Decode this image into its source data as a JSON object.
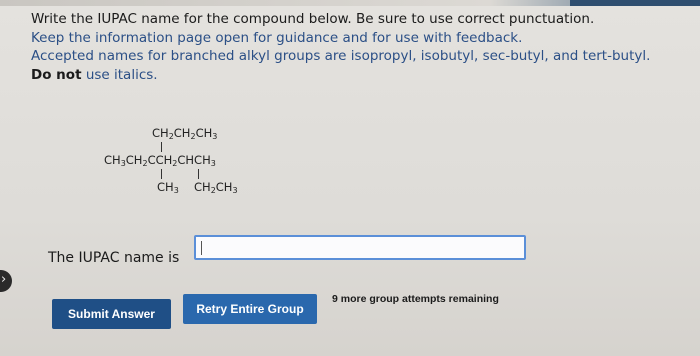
{
  "question": {
    "line1": "Write the IUPAC name for the compound below. Be sure to use correct punctuation.",
    "line2": "Keep the information page open for guidance and for use with feedback.",
    "line3": "Accepted names for branched alkyl groups are isopropyl, isobutyl, sec-butyl, and tert-butyl.",
    "line4_bold": "Do not",
    "line4_rest": " use italics."
  },
  "structure": {
    "top_sub": [
      "CH",
      "2",
      "CH",
      "2",
      "CH",
      "3"
    ],
    "main": [
      "CH",
      "3",
      "CH",
      "2",
      "CCH",
      "2",
      "CHCH",
      "3"
    ],
    "left_sub": [
      "CH",
      "3"
    ],
    "right_sub": [
      "CH",
      "2",
      "CH",
      "3"
    ]
  },
  "answer": {
    "label": "The IUPAC name is",
    "value": ""
  },
  "buttons": {
    "submit": "Submit Answer",
    "retry": "Retry Entire Group"
  },
  "attempts_text": "9 more group attempts remaining",
  "icons": {
    "side_arrow": "arrow-right-icon"
  },
  "colors": {
    "instruction_blue": "#2b4f86",
    "submit_button": "#1f4f86",
    "retry_button": "#2a68ad",
    "input_border": "#5b8fd8"
  }
}
